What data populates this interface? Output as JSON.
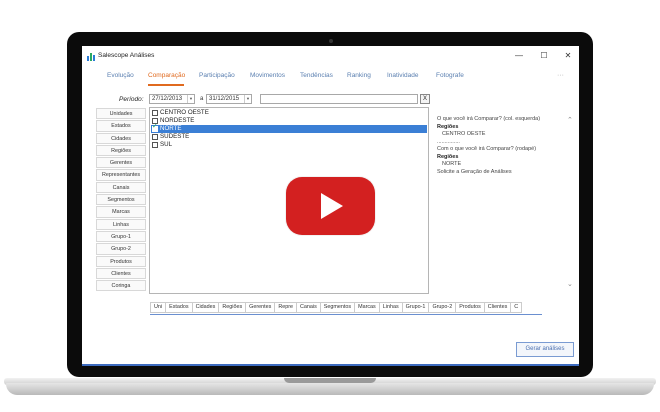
{
  "window": {
    "title": "Salescope Análises",
    "minimize": "—",
    "maximize": "☐",
    "close": "✕"
  },
  "tabs": [
    {
      "label": "Evolução"
    },
    {
      "label": "Comparação"
    },
    {
      "label": "Participação"
    },
    {
      "label": "Movimentos"
    },
    {
      "label": "Tendências"
    },
    {
      "label": "Ranking"
    },
    {
      "label": "Inatividade"
    },
    {
      "label": "Fotografe"
    }
  ],
  "tab_more": "···",
  "active_tab": "Comparação",
  "period": {
    "label": "Período:",
    "from": "27/12/2013",
    "separator": "a",
    "to": "31/12/2015",
    "search_value": "",
    "clear": "X"
  },
  "categories": [
    "Unidades",
    "Estados",
    "Cidades",
    "Regiões",
    "Gerentes",
    "Representantes",
    "Canais",
    "Segmentos",
    "Marcas",
    "Linhas",
    "Grupo-1",
    "Grupo-2",
    "Produtos",
    "Clientes",
    "Coringa"
  ],
  "regions": [
    {
      "label": "CENTRO OESTE",
      "checked": false,
      "selected": false
    },
    {
      "label": "NORDESTE",
      "checked": false,
      "selected": false
    },
    {
      "label": "NORTE",
      "checked": true,
      "selected": true
    },
    {
      "label": "SUDESTE",
      "checked": false,
      "selected": false
    },
    {
      "label": "SUL",
      "checked": false,
      "selected": false
    }
  ],
  "info": {
    "q1": "O que você irá Comparar? (col. esquerda)",
    "q1_group": "Regiões",
    "q1_value": "CENTRO OESTE",
    "divider": "...............",
    "q2": "Com o que você irá Comparar? (rodapé)",
    "q2_group": "Regiões",
    "q2_value": "NORTE",
    "hint": "Solicite a Geração de Análises"
  },
  "bottom_tabs": [
    "Uni",
    "Estados",
    "Cidades",
    "Regiões",
    "Gerentes",
    "Repre",
    "Canais",
    "Segmentos",
    "Marcas",
    "Linhas",
    "Grupo-1",
    "Grupo-2",
    "Produtos",
    "Clientes",
    "C"
  ],
  "generate_button": "Gerar análises",
  "colors": {
    "accent": "#e06a1f",
    "tab_text": "#5a7fb0",
    "selection": "#3b7fd5",
    "play": "#d32020",
    "bottom_bar": "#3d6bbf"
  }
}
